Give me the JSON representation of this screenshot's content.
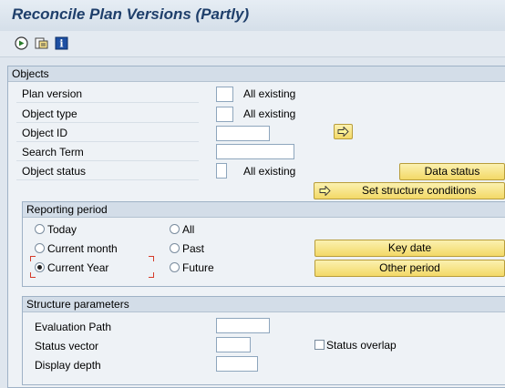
{
  "title": "Reconcile Plan Versions (Partly)",
  "toolbar": {
    "icons": [
      "execute-icon",
      "variant-icon",
      "info-icon"
    ]
  },
  "objects": {
    "header": "Objects",
    "plan_version_label": "Plan version",
    "plan_version_hint": "All existing",
    "object_type_label": "Object type",
    "object_type_hint": "All existing",
    "object_id_label": "Object ID",
    "search_term_label": "Search Term",
    "object_status_label": "Object status",
    "object_status_hint": "All existing",
    "data_status_button": "Data status",
    "set_structure_button": "Set structure conditions"
  },
  "reporting": {
    "header": "Reporting period",
    "options": [
      "Today",
      "All",
      "Current month",
      "Past",
      "Current Year",
      "Future"
    ],
    "selected": "Current Year",
    "key_date_button": "Key date",
    "other_period_button": "Other period"
  },
  "structure": {
    "header": "Structure parameters",
    "evaluation_path_label": "Evaluation Path",
    "status_vector_label": "Status vector",
    "display_depth_label": "Display depth",
    "status_overlap_label": "Status overlap"
  },
  "colors": {
    "accent": "#1f3f6b",
    "button": "#f3d967"
  }
}
